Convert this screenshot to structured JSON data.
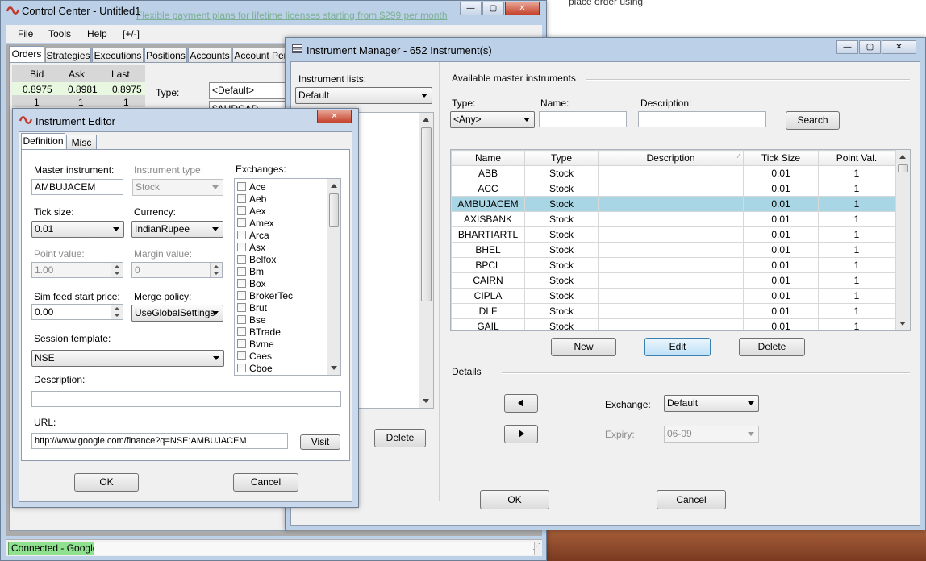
{
  "background": {
    "hint": "place order using"
  },
  "control_center": {
    "title": "Control Center - Untitled1",
    "menu": [
      "File",
      "Tools",
      "Help",
      "[+/-]"
    ],
    "tabs": [
      "Orders",
      "Strategies",
      "Executions",
      "Positions",
      "Accounts",
      "Account Per"
    ],
    "quote_headers": [
      "Bid",
      "Ask",
      "Last"
    ],
    "quote_values": [
      "0.8975",
      "0.8981",
      "0.8975"
    ],
    "quote_sizes": [
      "1",
      "1",
      "1"
    ],
    "type_label": "Type:",
    "type_value": "<Default>",
    "instrument_value": "$AUDCAD",
    "banner": "Flexible payment plans for lifetime licenses starting from $299 per month",
    "status": "Connected - Google"
  },
  "instrument_manager": {
    "title": "Instrument Manager - 652 Instrument(s)",
    "lists_label": "Instrument lists:",
    "lists_value": "Default",
    "delete_left_label": "Delete",
    "available_label": "Available master instruments",
    "type_label": "Type:",
    "type_value": "<Any>",
    "name_label": "Name:",
    "description_label": "Description:",
    "search_label": "Search",
    "columns": [
      "Name",
      "Type",
      "Description",
      "Tick Size",
      "Point Val."
    ],
    "rows": [
      {
        "name": "ABB",
        "type": "Stock",
        "description": "",
        "tick": "0.01",
        "point": "1"
      },
      {
        "name": "ACC",
        "type": "Stock",
        "description": "",
        "tick": "0.01",
        "point": "1"
      },
      {
        "name": "AMBUJACEM",
        "type": "Stock",
        "description": "",
        "tick": "0.01",
        "point": "1"
      },
      {
        "name": "AXISBANK",
        "type": "Stock",
        "description": "",
        "tick": "0.01",
        "point": "1"
      },
      {
        "name": "BHARTIARTL",
        "type": "Stock",
        "description": "",
        "tick": "0.01",
        "point": "1"
      },
      {
        "name": "BHEL",
        "type": "Stock",
        "description": "",
        "tick": "0.01",
        "point": "1"
      },
      {
        "name": "BPCL",
        "type": "Stock",
        "description": "",
        "tick": "0.01",
        "point": "1"
      },
      {
        "name": "CAIRN",
        "type": "Stock",
        "description": "",
        "tick": "0.01",
        "point": "1"
      },
      {
        "name": "CIPLA",
        "type": "Stock",
        "description": "",
        "tick": "0.01",
        "point": "1"
      },
      {
        "name": "DLF",
        "type": "Stock",
        "description": "",
        "tick": "0.01",
        "point": "1"
      },
      {
        "name": "GAIL",
        "type": "Stock",
        "description": "",
        "tick": "0.01",
        "point": "1"
      }
    ],
    "new_label": "New",
    "edit_label": "Edit",
    "delete_label": "Delete",
    "details_label": "Details",
    "exchange_label": "Exchange:",
    "exchange_value": "Default",
    "expiry_label": "Expiry:",
    "expiry_value": "06-09",
    "ok_label": "OK",
    "cancel_label": "Cancel"
  },
  "instrument_editor": {
    "title": "Instrument Editor",
    "tabs": [
      "Definition",
      "Misc"
    ],
    "master_label": "Master instrument:",
    "master_value": "AMBUJACEM",
    "itype_label": "Instrument type:",
    "itype_value": "Stock",
    "exchanges_label": "Exchanges:",
    "tick_label": "Tick size:",
    "tick_value": "0.01",
    "currency_label": "Currency:",
    "currency_value": "IndianRupee",
    "point_label": "Point value:",
    "point_value": "1.00",
    "margin_label": "Margin value:",
    "margin_value": "0",
    "sim_label": "Sim feed start price:",
    "sim_value": "0.00",
    "merge_label": "Merge policy:",
    "merge_value": "UseGlobalSettings",
    "session_label": "Session template:",
    "session_value": "NSE",
    "description_label": "Description:",
    "description_value": "",
    "url_label": "URL:",
    "url_value": "http://www.google.com/finance?q=NSE:AMBUJACEM",
    "visit_label": "Visit",
    "ok_label": "OK",
    "cancel_label": "Cancel",
    "exchanges": [
      "Ace",
      "Aeb",
      "Aex",
      "Amex",
      "Arca",
      "Asx",
      "Belfox",
      "Bm",
      "Box",
      "BrokerTec",
      "Brut",
      "Bse",
      "BTrade",
      "Bvme",
      "Caes",
      "Cboe"
    ]
  },
  "colors": {
    "selected_row": "#a9d6e4",
    "status_green": "#8fe08f",
    "quote_bg": "#e8f8e0"
  }
}
